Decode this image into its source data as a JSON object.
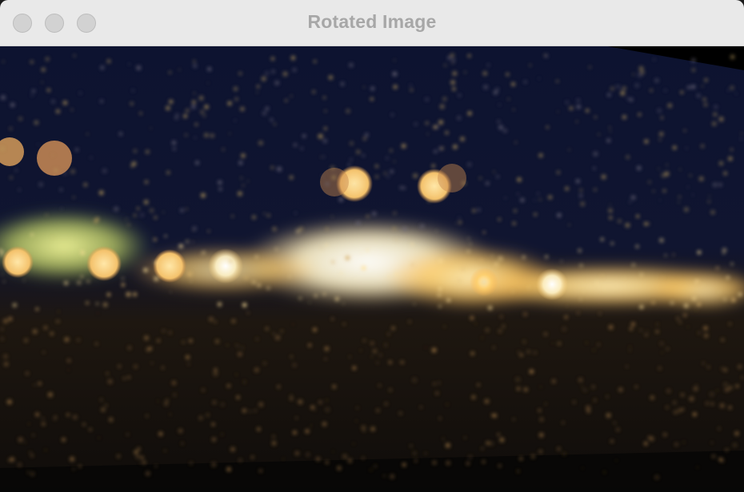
{
  "window": {
    "title": "Rotated Image"
  },
  "image": {
    "subject": "rain-on-glass-night-bokeh",
    "colors": {
      "sky": "#0d1330",
      "ground": "#14100c",
      "glow_warm": "#ffcf6b",
      "glow_white": "#fff6d8",
      "glow_green": "#e8f07a"
    }
  },
  "icons": {
    "close": "traffic-close-icon",
    "minimize": "traffic-minimize-icon",
    "zoom": "traffic-zoom-icon"
  }
}
